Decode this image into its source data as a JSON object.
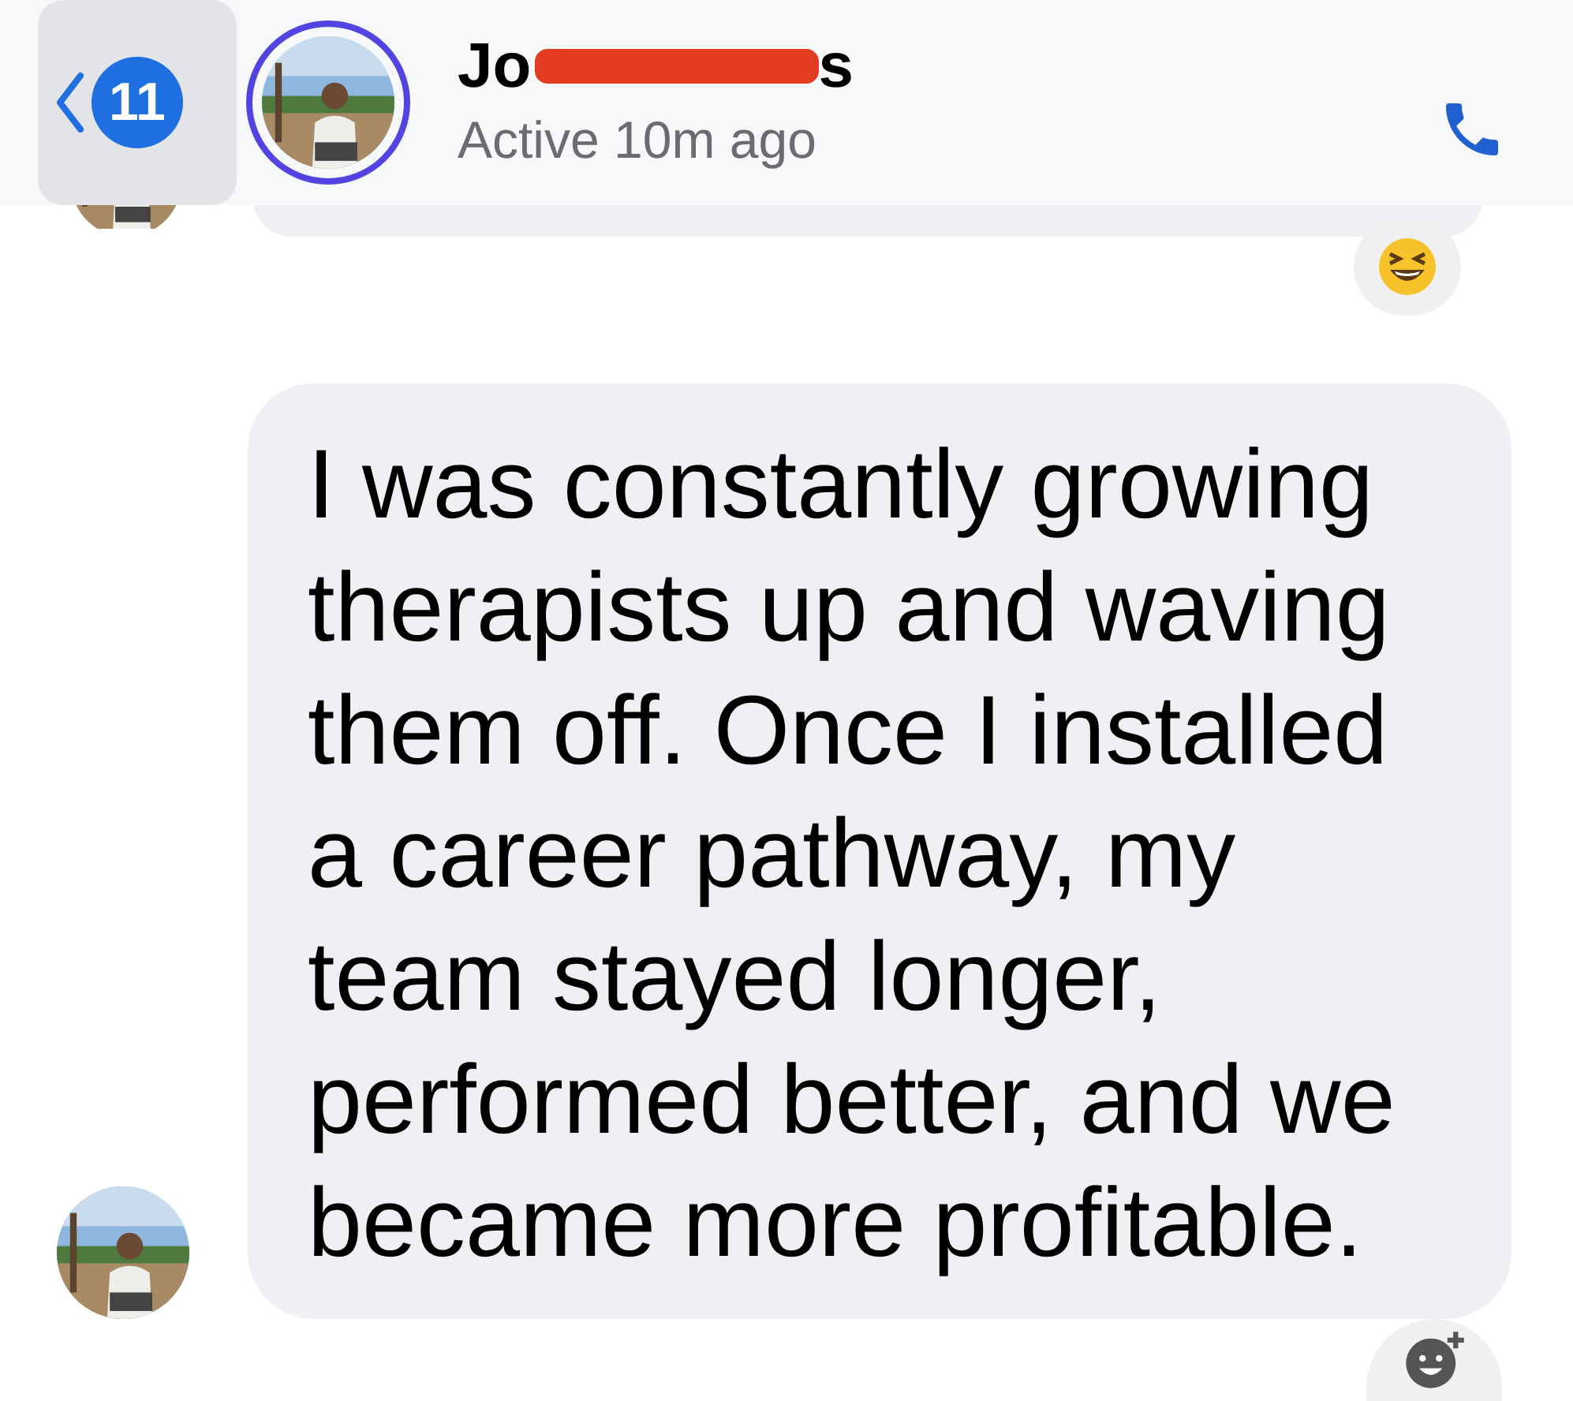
{
  "header": {
    "back_badge": "11",
    "name_parts": [
      "Jo",
      "s"
    ],
    "status": "Active 10m ago"
  },
  "messages": [
    {
      "kind": "partial"
    },
    {
      "kind": "text",
      "text": "I was constantly growing therapists up and waving them off. Once I installed a career pathway, my team stayed longer, performed better, and we became more profitable."
    }
  ]
}
